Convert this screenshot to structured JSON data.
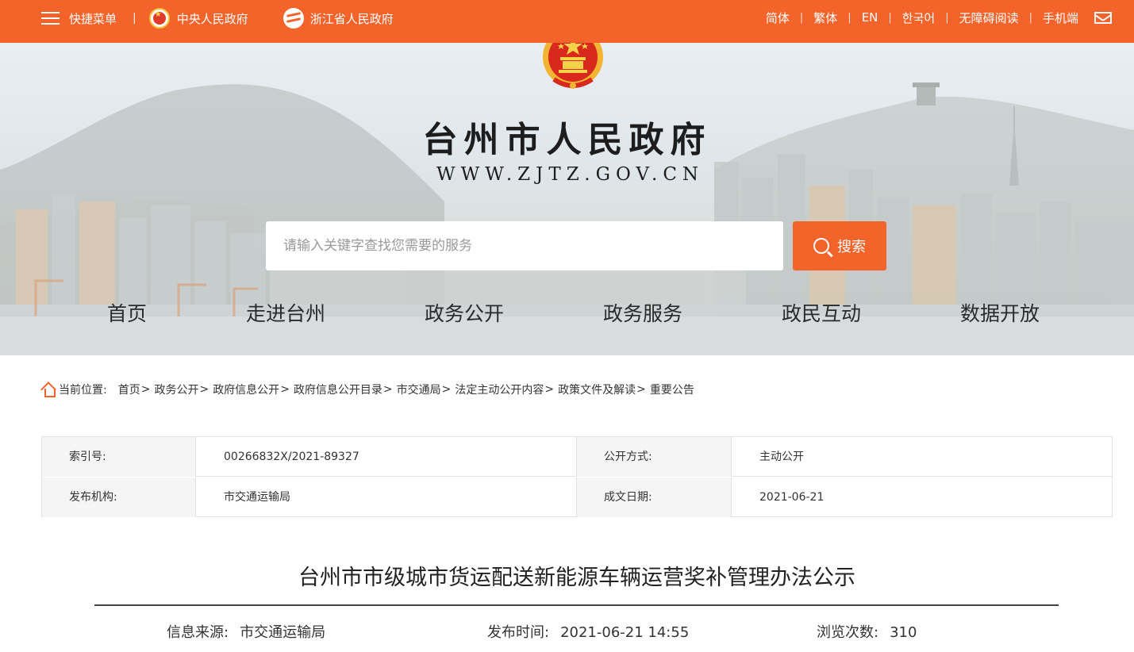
{
  "topbar": {
    "menu_label": "快捷菜单",
    "divider": "|",
    "link_central": "中央人民政府",
    "link_province": "浙江省人民政府",
    "right_links": [
      "简体",
      "繁体",
      "EN",
      "한국어",
      "无障碍阅读",
      "手机端"
    ],
    "mail_icon": "mail-icon"
  },
  "header": {
    "site_title": "台州市人民政府",
    "site_url": "WWW.ZJTZ.GOV.CN",
    "emblem": "national-emblem-icon"
  },
  "search": {
    "placeholder": "请输入关键字查找您需要的服务",
    "value": "",
    "button_label": "搜索"
  },
  "nav": {
    "items": [
      "首页",
      "走进台州",
      "政务公开",
      "政务服务",
      "政民互动",
      "数据开放"
    ]
  },
  "breadcrumb": {
    "prefix": "当前位置:",
    "items": [
      "首页",
      "政务公开",
      "政府信息公开",
      "政府信息公开目录",
      "市交通局",
      "法定主动公开内容",
      "政策文件及解读",
      "重要公告"
    ],
    "separator": ">"
  },
  "meta": {
    "index_label": "索引号:",
    "index_value": "00266832X/2021-89327",
    "method_label": "公开方式:",
    "method_value": "主动公开",
    "org_label": "发布机构:",
    "org_value": "市交通运输局",
    "date_label": "成文日期:",
    "date_value": "2021-06-21"
  },
  "article": {
    "title": "台州市市级城市货运配送新能源车辆运营奖补管理办法公示",
    "source_label": "信息来源:",
    "source_value": "市交通运输局",
    "publish_label": "发布时间:",
    "publish_value": "2021-06-21 14:55",
    "views_label": "浏览次数:",
    "views_value": "310"
  },
  "colors": {
    "brand_orange": "#f4632a",
    "emblem_red": "#d9281c",
    "emblem_gold": "#f2b431"
  }
}
